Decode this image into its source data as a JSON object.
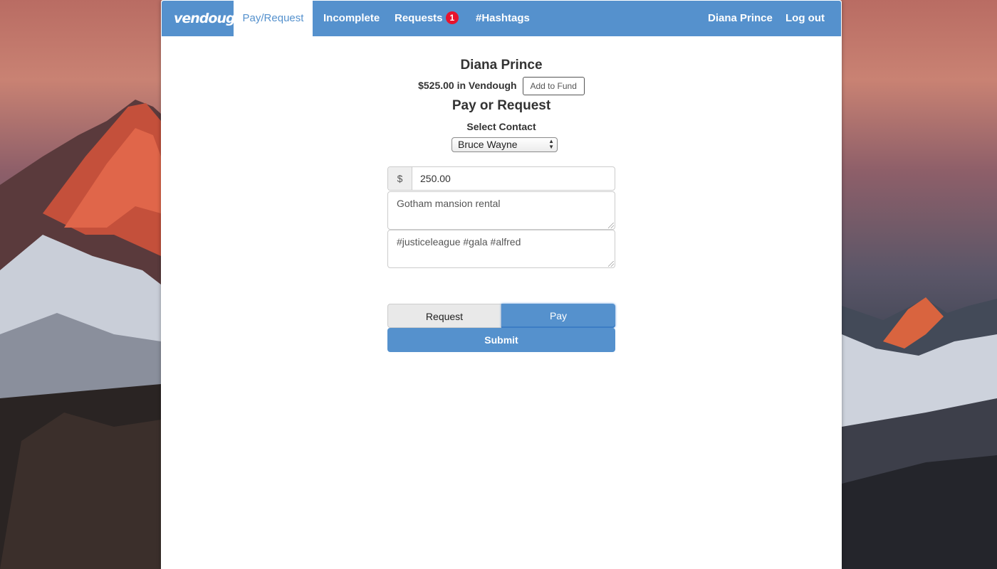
{
  "navbar": {
    "brand": "vendough",
    "tabs": [
      {
        "label": "Pay/Request",
        "active": true
      },
      {
        "label": "Incomplete"
      },
      {
        "label": "Requests",
        "badge": "1"
      },
      {
        "label": "#Hashtags"
      }
    ],
    "user_name": "Diana Prince",
    "logout_label": "Log out"
  },
  "profile": {
    "name": "Diana Prince",
    "balance_text": "$525.00 in Vendough",
    "add_fund_label": "Add to Fund"
  },
  "form": {
    "title": "Pay or Request",
    "contact_label": "Select Contact",
    "contact_selected": "Bruce Wayne",
    "currency_symbol": "$",
    "amount": "250.00",
    "memo": "Gotham mansion rental",
    "hashtags": "#justiceleague #gala #alfred",
    "request_label": "Request",
    "pay_label": "Pay",
    "selected_mode": "Pay",
    "submit_label": "Submit"
  },
  "colors": {
    "primary": "#5591cd",
    "badge": "#e8132d",
    "text": "#333333"
  },
  "icons": {
    "select_arrows": "updown-arrows-icon"
  }
}
